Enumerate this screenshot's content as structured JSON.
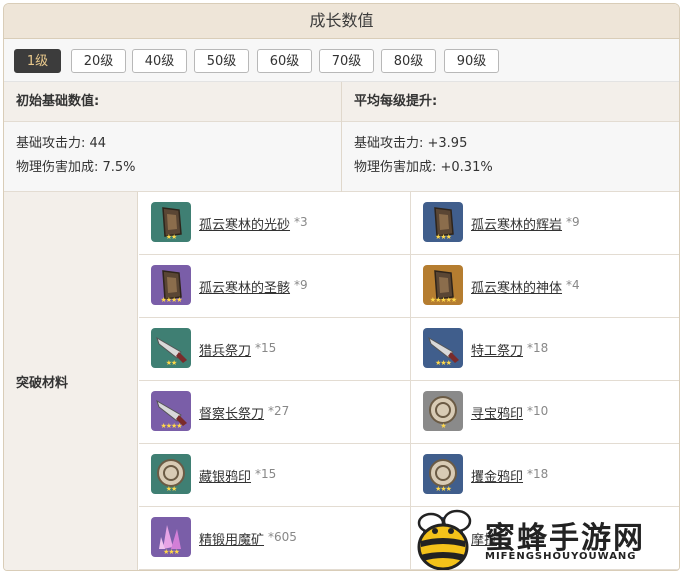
{
  "title": "成长数值",
  "levels": [
    "1级",
    "20级",
    "40级",
    "50级",
    "60级",
    "70级",
    "80级",
    "90级"
  ],
  "active_level": "1级",
  "initial": {
    "header": "初始基础数值:",
    "stats": [
      "基础攻击力: 44",
      "物理伤害加成: 7.5%"
    ]
  },
  "growth": {
    "header": "平均每级提升:",
    "stats": [
      "基础攻击力: +3.95",
      "物理伤害加成: +0.31%"
    ]
  },
  "materials": {
    "label": "突破材料",
    "items": [
      {
        "name": "孤云寒林的光砂",
        "count": "*3",
        "stars": "★★",
        "bg": "#3f7f73",
        "icon": "fragment-icon"
      },
      {
        "name": "孤云寒林的辉岩",
        "count": "*9",
        "stars": "★★★",
        "bg": "#405e8c",
        "icon": "fragment-icon"
      },
      {
        "name": "孤云寒林的圣骸",
        "count": "*9",
        "stars": "★★★★",
        "bg": "#7a5ea8",
        "icon": "fragment-icon"
      },
      {
        "name": "孤云寒林的神体",
        "count": "*4",
        "stars": "★★★★★",
        "bg": "#b57d30",
        "icon": "fragment-icon"
      },
      {
        "name": "猎兵祭刀",
        "count": "*15",
        "stars": "★★",
        "bg": "#3f7f73",
        "icon": "knife-icon"
      },
      {
        "name": "特工祭刀",
        "count": "*18",
        "stars": "★★★",
        "bg": "#405e8c",
        "icon": "knife-icon"
      },
      {
        "name": "督察长祭刀",
        "count": "*27",
        "stars": "★★★★",
        "bg": "#7a5ea8",
        "icon": "knife-icon"
      },
      {
        "name": "寻宝鸦印",
        "count": "*10",
        "stars": "★",
        "bg": "#8a8a8a",
        "icon": "seal-icon"
      },
      {
        "name": "藏银鸦印",
        "count": "*15",
        "stars": "★★",
        "bg": "#3f7f73",
        "icon": "seal-icon"
      },
      {
        "name": "攫金鸦印",
        "count": "*18",
        "stars": "★★★",
        "bg": "#405e8c",
        "icon": "seal-icon"
      },
      {
        "name": "精锻用魔矿",
        "count": "*605",
        "stars": "★★★",
        "bg": "#7a5ea8",
        "icon": "crystal-icon"
      },
      {
        "name": "摩拉",
        "count": "",
        "stars": "★★★",
        "bg": "#405e8c",
        "icon": "mora-icon"
      }
    ]
  },
  "watermark": {
    "text": "蜜蜂手游网",
    "sub": "MIFENGSHOUYOUWANG"
  }
}
